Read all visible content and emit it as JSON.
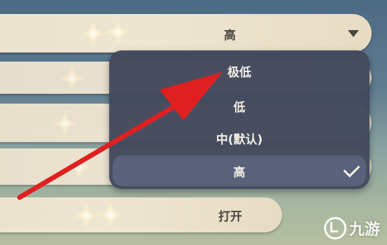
{
  "settings": {
    "current_row": {
      "value": "高"
    },
    "bottom_row": {
      "value": "打开"
    }
  },
  "dropdown": {
    "options": [
      {
        "label": "极低"
      },
      {
        "label": "低"
      },
      {
        "label": "中(默认)"
      },
      {
        "label": "高",
        "selected": true
      }
    ]
  },
  "icons": {
    "dropdown_arrow": "chevron-down-icon",
    "selected_mark": "checkmark-icon",
    "overlay_arrow": "red-arrow-annotation",
    "watermark_logo": "jiuyou-logo-icon"
  },
  "watermark": {
    "text": "九游"
  },
  "colors": {
    "panel": "#42495c",
    "selected": "#59627a",
    "row": "#ece3cf",
    "arrow": "#e02020"
  }
}
